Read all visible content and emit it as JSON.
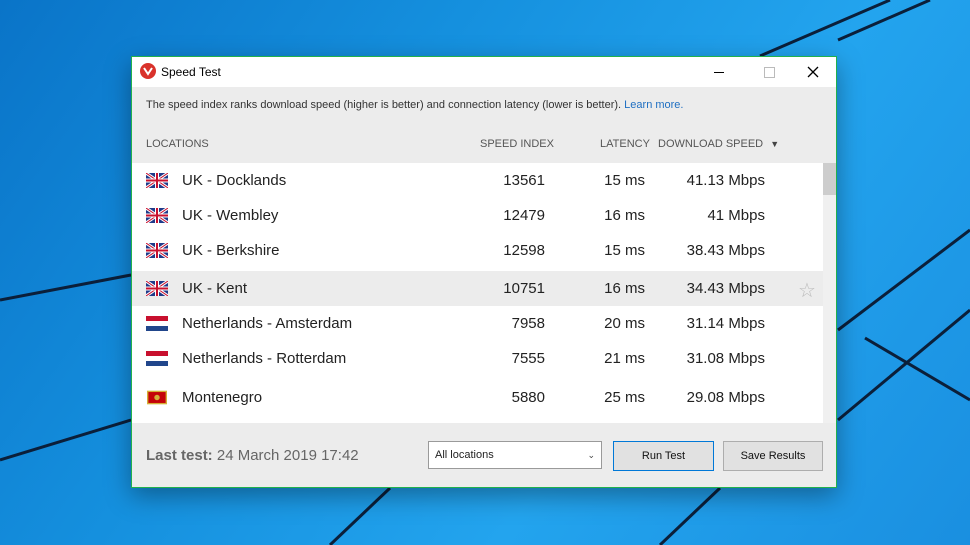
{
  "window": {
    "title": "Speed Test"
  },
  "info": {
    "text": "The speed index ranks download speed (higher is better) and connection latency (lower is better).",
    "link": "Learn more."
  },
  "columns": {
    "locations": "LOCATIONS",
    "speed_index": "SPEED INDEX",
    "latency": "LATENCY",
    "download_speed": "DOWNLOAD SPEED"
  },
  "rows": [
    {
      "flag": "uk-flag-icon",
      "location": "UK - Docklands",
      "speed_index": "13561",
      "latency": "15 ms",
      "download": "41.13 Mbps"
    },
    {
      "flag": "uk-flag-icon",
      "location": "UK - Wembley",
      "speed_index": "12479",
      "latency": "16 ms",
      "download": "41 Mbps"
    },
    {
      "flag": "uk-flag-icon",
      "location": "UK - Berkshire",
      "speed_index": "12598",
      "latency": "15 ms",
      "download": "38.43 Mbps"
    },
    {
      "flag": "uk-flag-icon",
      "location": "UK - Kent",
      "speed_index": "10751",
      "latency": "16 ms",
      "download": "34.43 Mbps"
    },
    {
      "flag": "netherlands-flag-icon",
      "location": "Netherlands - Amsterdam",
      "speed_index": "7958",
      "latency": "20 ms",
      "download": "31.14 Mbps"
    },
    {
      "flag": "netherlands-flag-icon",
      "location": "Netherlands - Rotterdam",
      "speed_index": "7555",
      "latency": "21 ms",
      "download": "31.08 Mbps"
    },
    {
      "flag": "montenegro-flag-icon",
      "location": "Montenegro",
      "speed_index": "5880",
      "latency": "25 ms",
      "download": "29.08 Mbps"
    }
  ],
  "footer": {
    "last_test_label": "Last test:",
    "last_test_value": "24 March 2019 17:42",
    "filter_selected": "All locations",
    "run_test": "Run Test",
    "save_results": "Save Results"
  },
  "colors": {
    "accent": "#0078d7",
    "link": "#1f6fc2",
    "window_border": "#22b14c"
  }
}
